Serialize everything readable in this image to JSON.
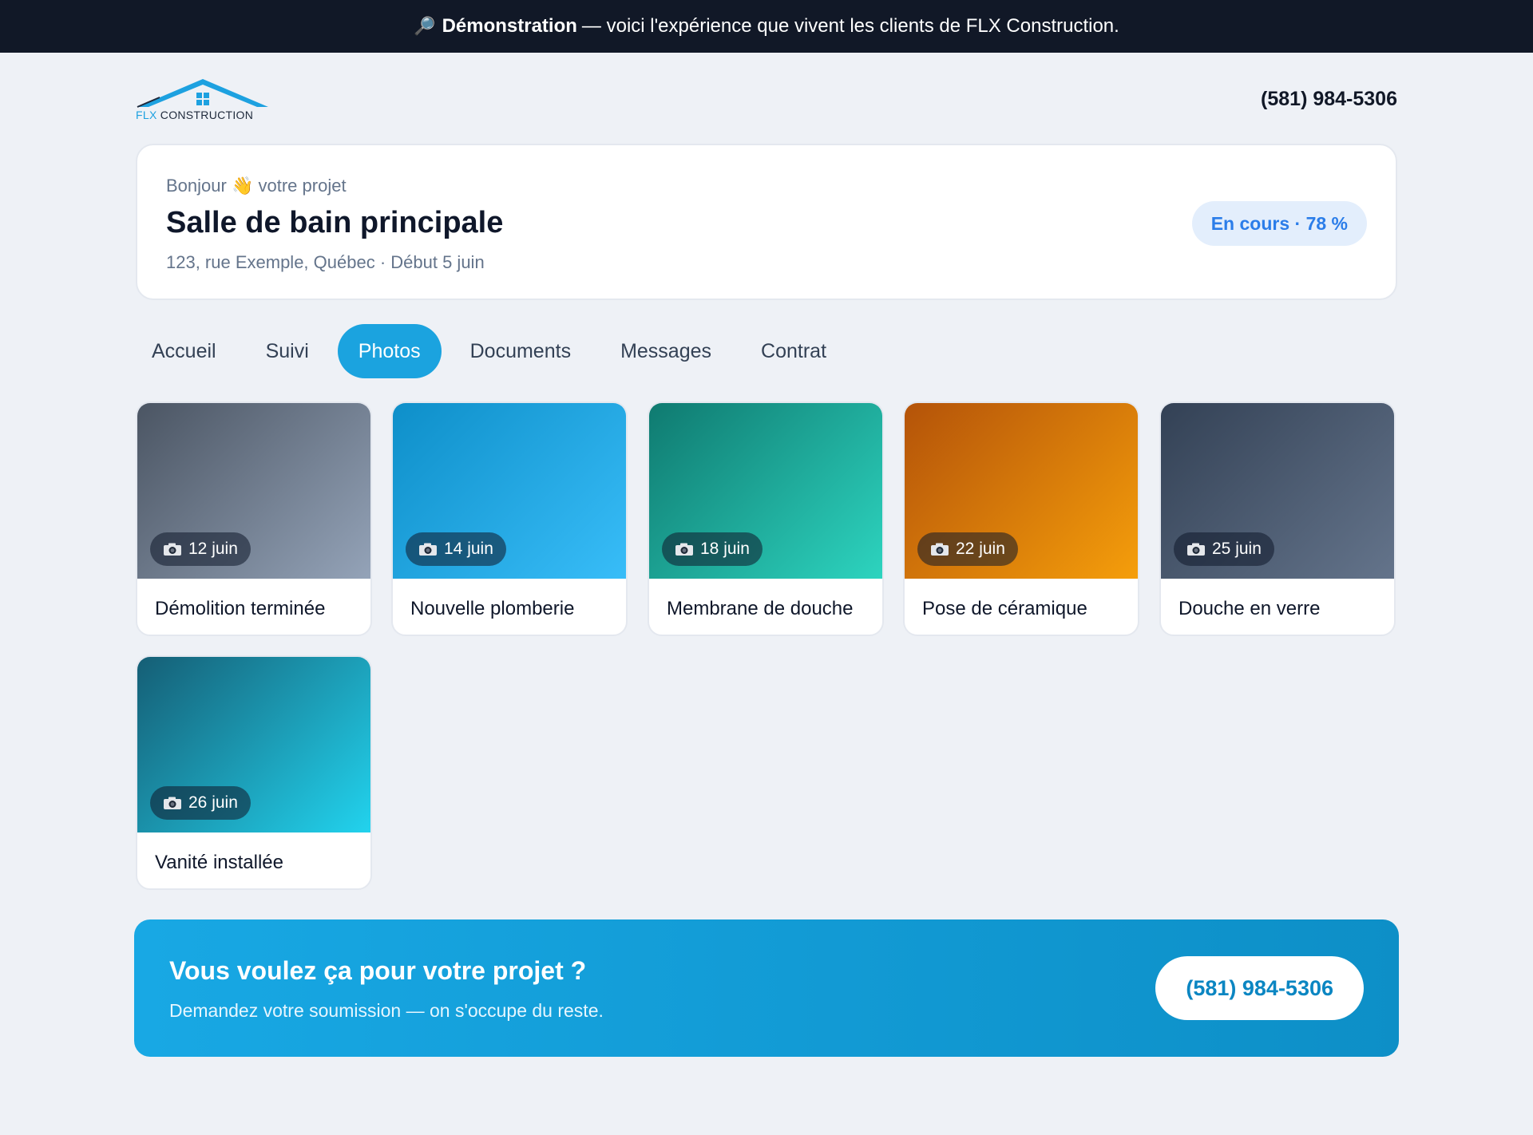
{
  "demo_banner": {
    "icon": "magnifier-icon",
    "strong": "Démonstration",
    "rest": "— voici l'expérience que vivent les clients de FLX Construction."
  },
  "header": {
    "logo_flx": "FLX",
    "logo_construction": "CONSTRUCTION",
    "phone": "(581) 984-5306"
  },
  "project": {
    "greeting_before": "Bonjour",
    "greeting_emoji": "👋",
    "greeting_after": "votre projet",
    "title": "Salle de bain principale",
    "meta": "123, rue Exemple, Québec · Début 5 juin",
    "status": "En cours · 78 %"
  },
  "tabs": [
    {
      "label": "Accueil",
      "active": false
    },
    {
      "label": "Suivi",
      "active": false
    },
    {
      "label": "Photos",
      "active": true
    },
    {
      "label": "Documents",
      "active": false
    },
    {
      "label": "Messages",
      "active": false
    },
    {
      "label": "Contrat",
      "active": false
    }
  ],
  "photos": [
    {
      "date": "12 juin",
      "caption": "Démolition terminée",
      "colors": [
        "#4b5563",
        "#94a3b8"
      ]
    },
    {
      "date": "14 juin",
      "caption": "Nouvelle plomberie",
      "colors": [
        "#0e8fc9",
        "#38bdf8"
      ]
    },
    {
      "date": "18 juin",
      "caption": "Membrane de douche",
      "colors": [
        "#0f7a70",
        "#2dd4bf"
      ]
    },
    {
      "date": "22 juin",
      "caption": "Pose de céramique",
      "colors": [
        "#b45309",
        "#f59e0b"
      ]
    },
    {
      "date": "25 juin",
      "caption": "Douche en verre",
      "colors": [
        "#334155",
        "#64748b"
      ]
    },
    {
      "date": "26 juin",
      "caption": "Vanité installée",
      "colors": [
        "#155e75",
        "#22d3ee"
      ]
    }
  ],
  "cta": {
    "title": "Vous voulez ça pour votre projet ?",
    "subtitle": "Demandez votre soumission — on s'occupe du reste.",
    "button": "(581) 984-5306"
  }
}
